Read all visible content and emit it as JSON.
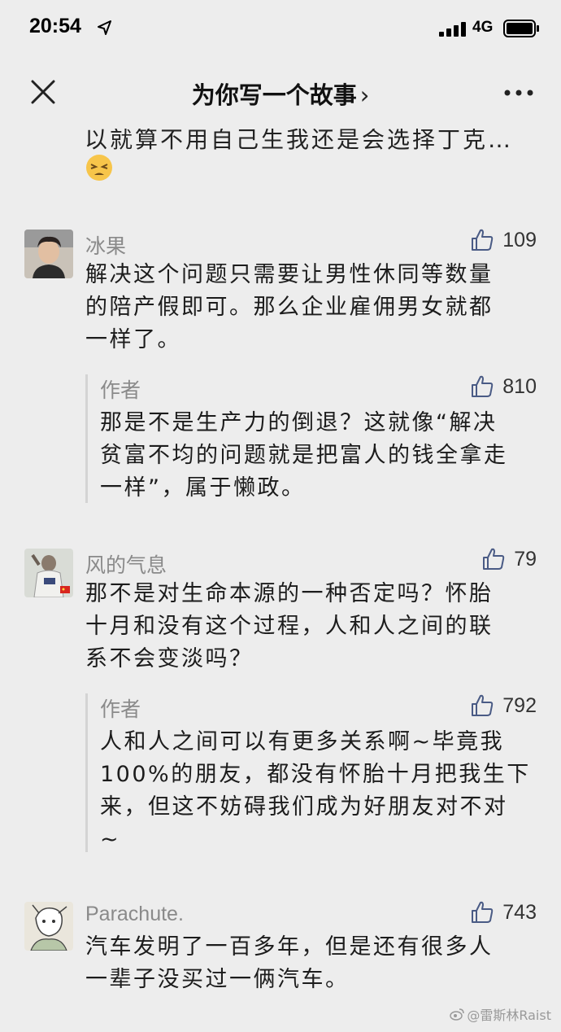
{
  "status_bar": {
    "time": "20:54",
    "network": "4G"
  },
  "nav": {
    "title": "为你写一个故事",
    "chevron": "›"
  },
  "top_continuation": {
    "text": "以就算不用自己生我还是会选择丁克…"
  },
  "comments": [
    {
      "username": "冰果",
      "likes": "109",
      "lines": [
        "解决这个问题只需要让男性休同等数量",
        "的陪产假即可。那么企业雇佣男女就都",
        "一样了。"
      ],
      "reply": {
        "author": "作者",
        "likes": "810",
        "lines": [
          "那是不是生产力的倒退？这就像“解决",
          "贫富不均的问题就是把富人的钱全拿走",
          "一样”，属于懒政。"
        ]
      }
    },
    {
      "username": "风的气息",
      "likes": "79",
      "lines": [
        "那不是对生命本源的一种否定吗？怀胎",
        "十月和没有这个过程，人和人之间的联",
        "系不会变淡吗？"
      ],
      "reply": {
        "author": "作者",
        "likes": "792",
        "lines": [
          "人和人之间可以有更多关系啊~毕竟我",
          "100%的朋友，都没有怀胎十月把我生下",
          "来，但这不妨碍我们成为好朋友对不对",
          "~"
        ]
      }
    },
    {
      "username": "Parachute.",
      "likes": "743",
      "lines": [
        "汽车发明了一百多年，但是还有很多人",
        "一辈子没买过一俩汽车。"
      ]
    }
  ],
  "watermark": {
    "text": "@雷斯林Raist"
  },
  "icons": {
    "location": "location-arrow-icon",
    "signal": "signal-bars-icon",
    "battery": "battery-icon",
    "close": "close-icon",
    "more": "more-dots-icon",
    "like": "thumbs-up-icon"
  },
  "colors": {
    "background": "#ededed",
    "username": "#8a8a8a",
    "text": "#1c1c1c"
  }
}
